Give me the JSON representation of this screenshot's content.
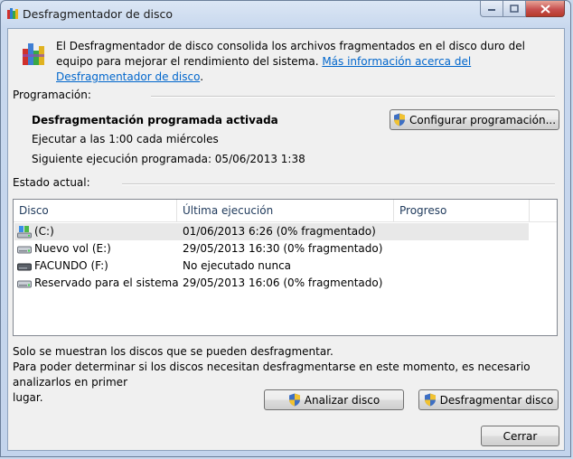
{
  "window": {
    "title": "Desfragmentador de disco"
  },
  "intro": {
    "text": "El Desfragmentador de disco consolida los archivos fragmentados en el disco duro del equipo para mejorar el rendimiento del sistema. ",
    "link": "Más información acerca del Desfragmentador de disco",
    "after_link": "."
  },
  "schedule": {
    "section_label": "Programación:",
    "status": "Desfragmentación programada activada",
    "run_at": "Ejecutar a las 1:00 cada miércoles",
    "next_run": "Siguiente ejecución programada: 05/06/2013 1:38",
    "configure_button": "Configurar programación..."
  },
  "current": {
    "section_label": "Estado actual:",
    "columns": [
      "Disco",
      "Última ejecución",
      "Progreso"
    ],
    "disks": [
      {
        "name": "(C:)",
        "last_run": "01/06/2013 6:26 (0% fragmentado)",
        "progress": "",
        "icon": "system-drive-icon"
      },
      {
        "name": "Nuevo vol (E:)",
        "last_run": "29/05/2013 16:30 (0% fragmentado)",
        "progress": "",
        "icon": "hard-drive-icon"
      },
      {
        "name": "FACUNDO (F:)",
        "last_run": "No ejecutado nunca",
        "progress": "",
        "icon": "removable-drive-icon"
      },
      {
        "name": "Reservado para el sistema",
        "last_run": "29/05/2013 16:06 (0% fragmentado)",
        "progress": "",
        "icon": "hard-drive-icon"
      }
    ]
  },
  "notes": {
    "line1": "Solo se muestran los discos que se pueden desfragmentar.",
    "line2": "Para poder determinar si los discos necesitan desfragmentarse en este momento, es necesario analizarlos en primer",
    "line3": "lugar."
  },
  "actions": {
    "analyze_button": "Analizar disco",
    "defrag_button": "Desfragmentar disco",
    "close_button": "Cerrar"
  }
}
